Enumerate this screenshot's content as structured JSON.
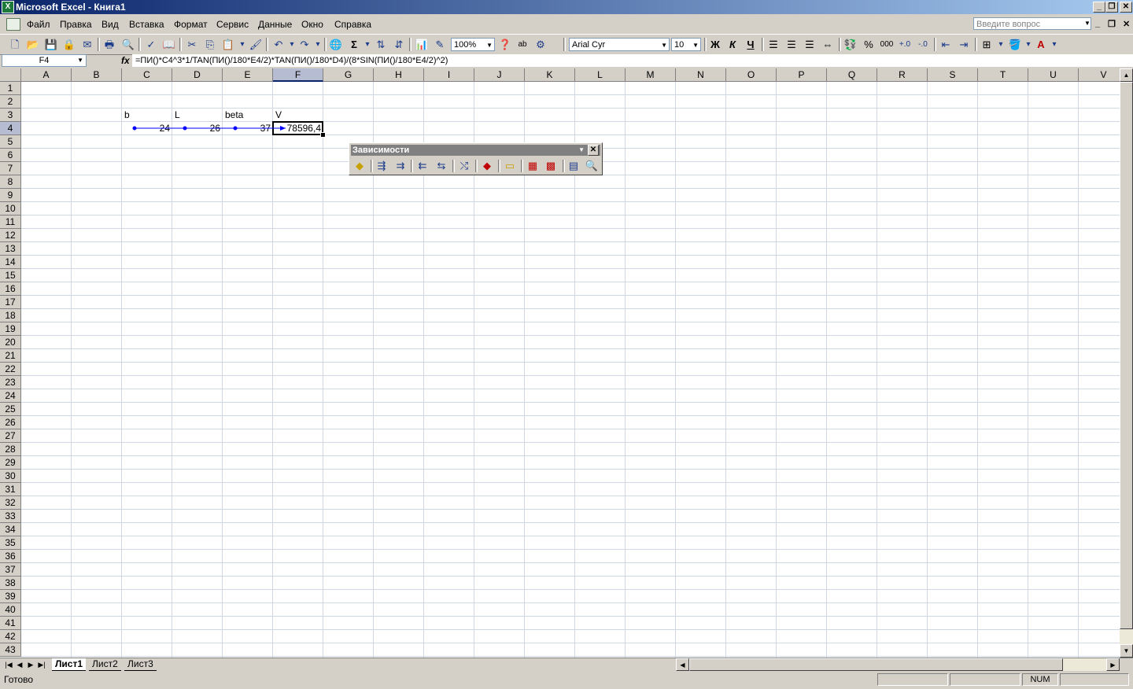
{
  "window": {
    "title": "Microsoft Excel - Книга1"
  },
  "menu": {
    "items": [
      "Файл",
      "Правка",
      "Вид",
      "Вставка",
      "Формат",
      "Сервис",
      "Данные",
      "Окно",
      "Справка"
    ],
    "ask_placeholder": "Введите вопрос"
  },
  "toolbar": {
    "zoom": "100%",
    "font_name": "Arial Cyr",
    "font_size": "10",
    "bold": "Ж",
    "italic": "К",
    "underline": "Ч",
    "sum": "Σ",
    "percent": "%",
    "thousands": "000",
    "abc": "ab"
  },
  "formula_bar": {
    "name_box": "F4",
    "fx": "fx",
    "formula": "=ПИ()*C4^3*1/TAN(ПИ()/180*E4/2)*TAN(ПИ()/180*D4)/(8*SIN(ПИ()/180*E4/2)^2)"
  },
  "sheet": {
    "columns": [
      "A",
      "B",
      "C",
      "D",
      "E",
      "F",
      "G",
      "H",
      "I",
      "J",
      "K",
      "L",
      "M",
      "N",
      "O",
      "P",
      "Q",
      "R",
      "S",
      "T",
      "U",
      "V"
    ],
    "row_count": 43,
    "selected_column": "F",
    "selected_row": 4,
    "cells": {
      "C3": "b",
      "D3": "L",
      "E3": "beta",
      "F3": "V",
      "C4": "24",
      "D4": "26",
      "E4": "37",
      "F4": "78596,4"
    }
  },
  "deps_toolbar": {
    "title": "Зависимости"
  },
  "tabs": [
    "Лист1",
    "Лист2",
    "Лист3"
  ],
  "status": {
    "ready": "Готово",
    "num": "NUM"
  },
  "colors": {
    "title_start": "#0a246a",
    "title_end": "#a6caf0",
    "trace_arrow": "#0000ff"
  }
}
